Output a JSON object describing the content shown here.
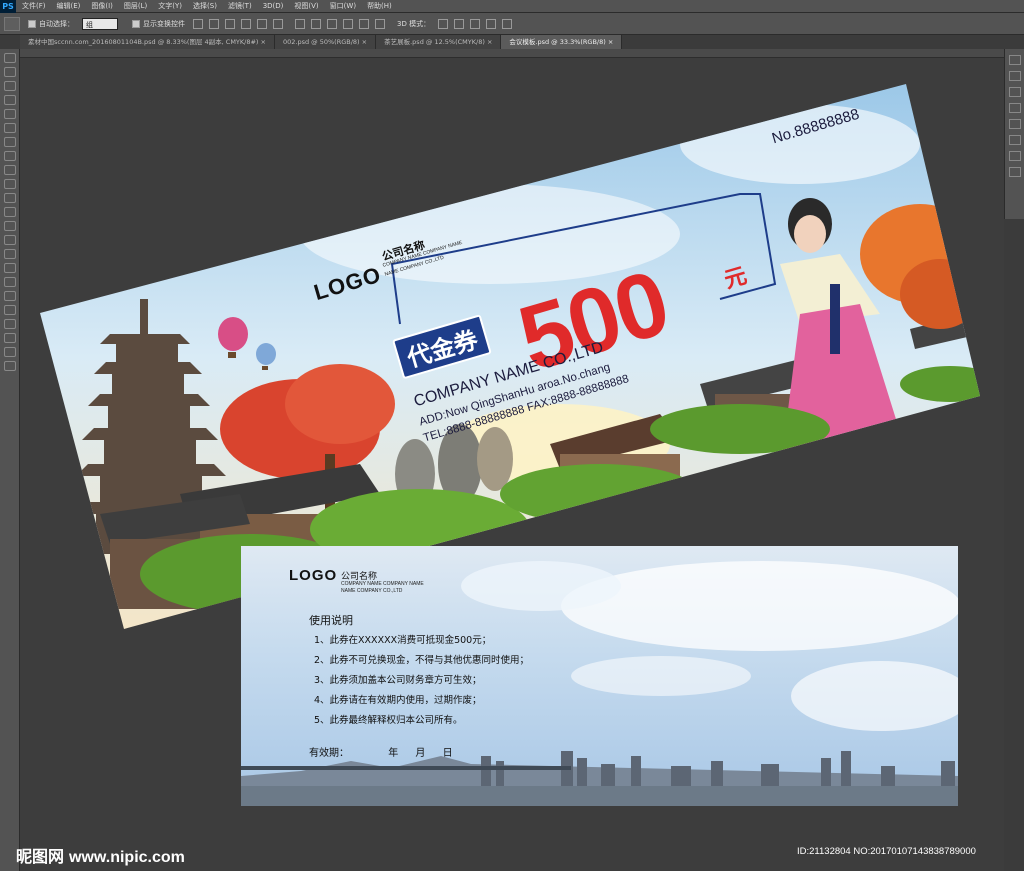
{
  "app": {
    "menu": [
      "文件(F)",
      "编辑(E)",
      "图像(I)",
      "图层(L)",
      "文字(Y)",
      "选择(S)",
      "滤镜(T)",
      "3D(D)",
      "视图(V)",
      "窗口(W)",
      "帮助(H)"
    ],
    "ps_logo": "PS",
    "options": {
      "auto_select_label": "自动选择：",
      "auto_select_value": "组",
      "show_transform_label": "显示变换控件",
      "mode_3d_label": "3D 模式："
    },
    "tabs": [
      {
        "label": "素材中国sccnn.com_20160801104B.psd @ 8.33%(图层 4副本, CMYK/8#) ×",
        "active": false
      },
      {
        "label": "002.psd @ 50%(RGB/8) ×",
        "active": false
      },
      {
        "label": "茶艺展板.psd @ 12.5%(CMYK/8) ×",
        "active": false
      },
      {
        "label": "会议模板.psd @ 33.3%(RGB/8) ×",
        "active": true
      }
    ]
  },
  "voucher_front": {
    "number": "No.88888888",
    "logo": "LOGO",
    "company_cn": "公司名称",
    "company_small_1": "COMPANY NAME COMPANY NAME",
    "company_small_2": "NAME COMPANY CO.,LTD",
    "amount": "500",
    "currency": "元",
    "badge": "代金券",
    "company_en": "COMPANY NAME CO.,LTD",
    "address": "ADD:Now QingShanHu aroa.No.chang",
    "tel_fax": "TEL:8888-88888888   FAX:8888-88888888"
  },
  "voucher_back": {
    "logo": "LOGO",
    "company_cn": "公司名称",
    "company_small_1": "COMPANY NAME COMPANY NAME",
    "company_small_2": "NAME COMPANY CO.,LTD",
    "heading": "使用说明",
    "rules": [
      "1、此券在XXXXXX消费可抵现金500元；",
      "2、此券不可兑换现金，不得与其他优惠同时使用；",
      "3、此券须加盖本公司财务章方可生效；",
      "4、此券请在有效期内使用，过期作废；",
      "5、此券最终解释权归本公司所有。"
    ],
    "valid_label": "有效期：",
    "valid_year": "年",
    "valid_month": "月",
    "valid_day": "日"
  },
  "watermark": {
    "site_cn": "昵图网",
    "site_url": "www.nipic.com",
    "id_info": "ID:21132804 NO:20170107143838789000"
  },
  "colors": {
    "accent_red": "#e02a2a",
    "badge_blue": "#1e3d8a",
    "ps_dark": "#535353"
  }
}
